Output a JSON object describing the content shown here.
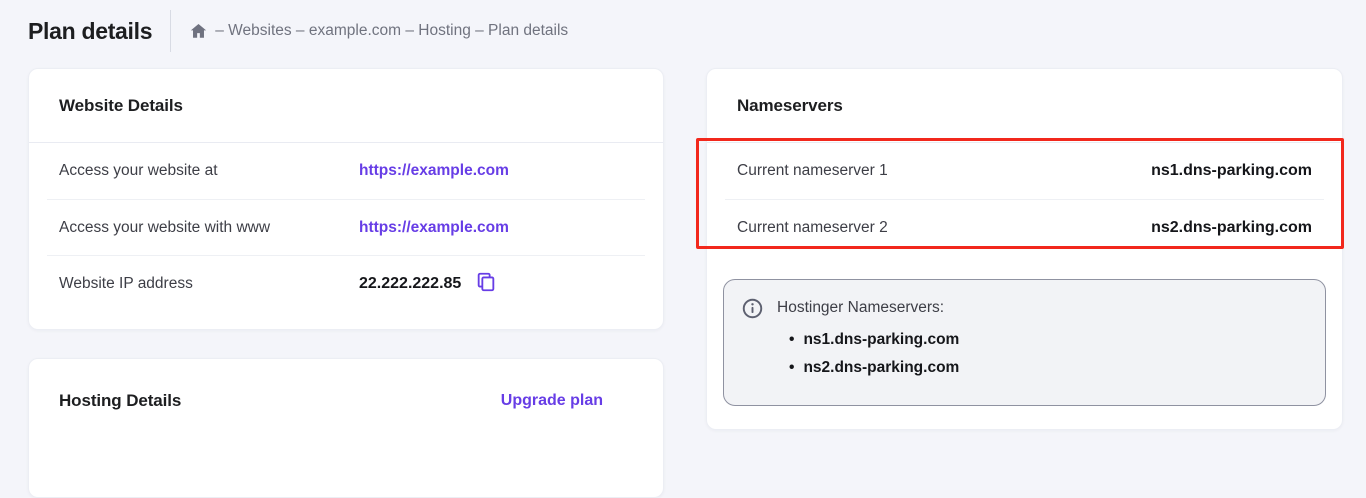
{
  "page": {
    "title": "Plan details"
  },
  "breadcrumb": {
    "display": "– Websites – example.com – Hosting – Plan details",
    "separator": "–",
    "items": [
      "Websites",
      "example.com",
      "Hosting",
      "Plan details"
    ]
  },
  "website_details": {
    "title": "Website Details",
    "rows": [
      {
        "label": "Access your website at",
        "value": "https://example.com",
        "type": "link"
      },
      {
        "label": "Access your website with www",
        "value": "https://example.com",
        "type": "link"
      },
      {
        "label": "Website IP address",
        "value": "22.222.222.85",
        "type": "copy"
      }
    ]
  },
  "hosting_details": {
    "title": "Hosting Details",
    "action_label": "Upgrade plan"
  },
  "nameservers": {
    "title": "Nameservers",
    "rows": [
      {
        "label": "Current nameserver 1",
        "value": "ns1.dns-parking.com"
      },
      {
        "label": "Current nameserver 2",
        "value": "ns2.dns-parking.com"
      }
    ],
    "info": {
      "heading": "Hostinger Nameservers:",
      "items": [
        "ns1.dns-parking.com",
        "ns2.dns-parking.com"
      ]
    }
  },
  "icons": {
    "home": "home-icon",
    "copy": "copy-icon",
    "info": "info-icon"
  },
  "colors": {
    "accent_purple": "#673de6",
    "annotation_red": "#f2281c",
    "page_background": "#f4f5fa",
    "card_background": "#ffffff"
  }
}
